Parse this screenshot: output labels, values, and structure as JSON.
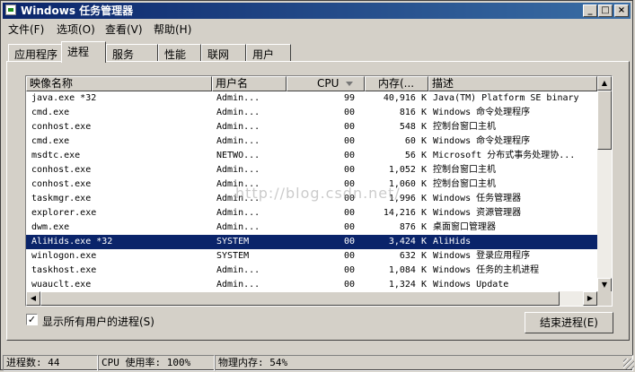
{
  "window": {
    "title": "Windows 任务管理器",
    "buttons": {
      "minimize": "_",
      "maximize": "□",
      "close": "×"
    }
  },
  "menu": [
    "文件(F)",
    "选项(O)",
    "查看(V)",
    "帮助(H)"
  ],
  "tabs": [
    {
      "label": "应用程序",
      "active": false
    },
    {
      "label": "进程",
      "active": true
    },
    {
      "label": "服务",
      "active": false
    },
    {
      "label": "性能",
      "active": false
    },
    {
      "label": "联网",
      "active": false
    },
    {
      "label": "用户",
      "active": false
    }
  ],
  "table": {
    "columns": [
      "映像名称",
      "用户名",
      "CPU",
      "内存(...",
      "描述"
    ],
    "sort_column": "CPU",
    "rows": [
      {
        "image": "java.exe *32",
        "user": "Admin...",
        "cpu": "99",
        "mem": "40,916 K",
        "desc": "Java(TM) Platform SE binary",
        "selected": false
      },
      {
        "image": "cmd.exe",
        "user": "Admin...",
        "cpu": "00",
        "mem": "816 K",
        "desc": "Windows 命令处理程序",
        "selected": false
      },
      {
        "image": "conhost.exe",
        "user": "Admin...",
        "cpu": "00",
        "mem": "548 K",
        "desc": "控制台窗口主机",
        "selected": false
      },
      {
        "image": "cmd.exe",
        "user": "Admin...",
        "cpu": "00",
        "mem": "60 K",
        "desc": "Windows 命令处理程序",
        "selected": false
      },
      {
        "image": "msdtc.exe",
        "user": "NETWO...",
        "cpu": "00",
        "mem": "56 K",
        "desc": "Microsoft 分布式事务处理协...",
        "selected": false
      },
      {
        "image": "conhost.exe",
        "user": "Admin...",
        "cpu": "00",
        "mem": "1,052 K",
        "desc": "控制台窗口主机",
        "selected": false
      },
      {
        "image": "conhost.exe",
        "user": "Admin...",
        "cpu": "00",
        "mem": "1,060 K",
        "desc": "控制台窗口主机",
        "selected": false
      },
      {
        "image": "taskmgr.exe",
        "user": "Admin...",
        "cpu": "00",
        "mem": "1,996 K",
        "desc": "Windows 任务管理器",
        "selected": false
      },
      {
        "image": "explorer.exe",
        "user": "Admin...",
        "cpu": "00",
        "mem": "14,216 K",
        "desc": "Windows 资源管理器",
        "selected": false
      },
      {
        "image": "dwm.exe",
        "user": "Admin...",
        "cpu": "00",
        "mem": "876 K",
        "desc": "桌面窗口管理器",
        "selected": false
      },
      {
        "image": "AliHids.exe *32",
        "user": "SYSTEM",
        "cpu": "00",
        "mem": "3,424 K",
        "desc": "AliHids",
        "selected": true
      },
      {
        "image": "winlogon.exe",
        "user": "SYSTEM",
        "cpu": "00",
        "mem": "632 K",
        "desc": "Windows 登录应用程序",
        "selected": false
      },
      {
        "image": "taskhost.exe",
        "user": "Admin...",
        "cpu": "00",
        "mem": "1,084 K",
        "desc": "Windows 任务的主机进程",
        "selected": false
      },
      {
        "image": "wuauclt.exe",
        "user": "Admin...",
        "cpu": "00",
        "mem": "1,324 K",
        "desc": "Windows Update",
        "selected": false
      }
    ]
  },
  "show_all_users": {
    "label": "显示所有用户的进程(S)",
    "checked": true,
    "mark": "✓"
  },
  "end_process_label": "结束进程(E)",
  "status": {
    "processes": "进程数: 44",
    "cpu": "CPU 使用率: 100%",
    "memory": "物理内存: 54%"
  },
  "watermark": "http://blog.csdn.net/"
}
